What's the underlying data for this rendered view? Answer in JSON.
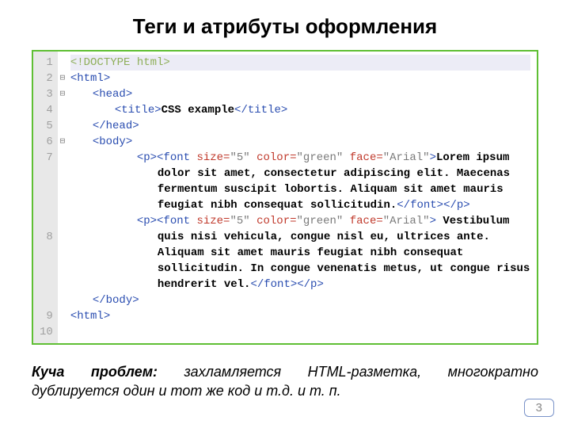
{
  "title": "Теги и атрибуты оформления",
  "gutter_fill": {
    "7h": "",
    "8h": ""
  },
  "code": {
    "l1": {
      "num": "1",
      "fold": "",
      "doctype": "<!DOCTYPE html>"
    },
    "l2": {
      "num": "2",
      "fold": "⊟",
      "t": "<html>"
    },
    "l3": {
      "num": "3",
      "fold": "⊟",
      "t": "<head>"
    },
    "l4": {
      "num": "4",
      "fold": "",
      "t1": "<title>",
      "tx": "CSS example",
      "t2": "</title>"
    },
    "l5": {
      "num": "5",
      "fold": "",
      "t": "</head>"
    },
    "l6": {
      "num": "6",
      "fold": "⊟",
      "t": "<body>"
    },
    "l7": {
      "num": "7",
      "fold": "",
      "p_open": "<p>",
      "font_open": "<font",
      "sp": " ",
      "a_size": "size=",
      "v_size": "\"5\"",
      "a_color": "color=",
      "v_color": "\"green\"",
      "a_face": "face=",
      "v_face": "\"Arial\"",
      "gt": ">",
      "lorem": "Lorem ipsum dolor sit amet, consectetur adipiscing elit. Maecenas fermentum suscipit lobortis. Aliquam sit amet mauris feugiat nibh consequat sollicitudin.",
      "font_close": "</font>",
      "p_close": "</p>"
    },
    "l8": {
      "num": "8",
      "fold": "",
      "p_open": "<p>",
      "font_open": "<font",
      "sp": " ",
      "a_size": "size=",
      "v_size": "\"5\"",
      "a_color": "color=",
      "v_color": "\"green\"",
      "a_face": "face=",
      "v_face": "\"Arial\"",
      "gt": ">",
      "vest": " Vestibulum quis nisi vehicula, congue nisl eu, ultrices ante. Aliquam sit amet mauris feugiat nibh consequat sollicitudin. In congue venenatis metus, ut congue risus hendrerit vel.",
      "font_close": "</font>",
      "p_close": "</p>"
    },
    "l9": {
      "num": "9",
      "fold": "",
      "t": "</body>"
    },
    "l10": {
      "num": "10",
      "fold": "",
      "t": "<html>"
    }
  },
  "caption_bold": "Куча проблем:",
  "caption_rest": " захламляется HTML-разметка, многократно дублируется один и тот же код и т.д. и т. п.",
  "page_number": "3"
}
